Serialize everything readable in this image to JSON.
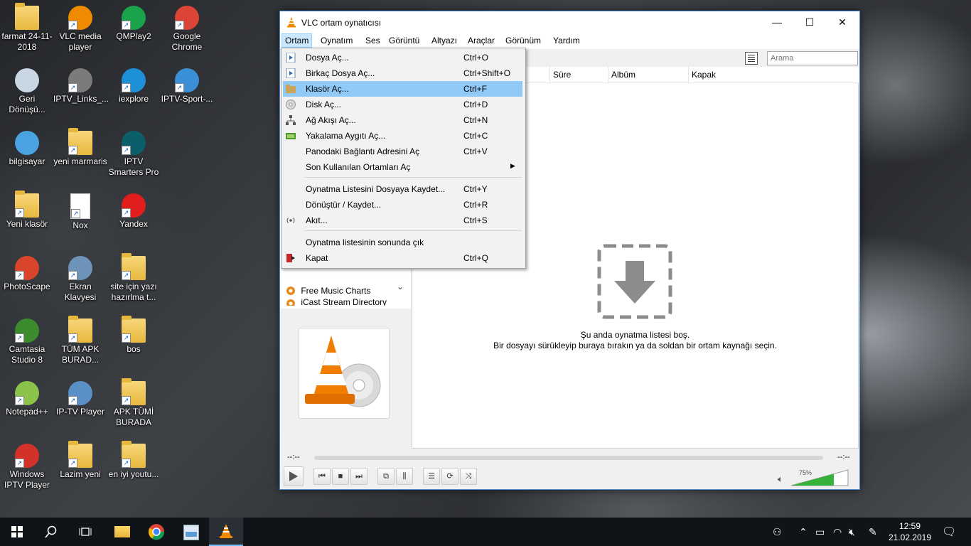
{
  "desktop": {
    "icons": [
      {
        "label": "farmat 24-11-2018",
        "icon": "folder-icon"
      },
      {
        "label": "VLC media player",
        "icon": "vlc-icon"
      },
      {
        "label": "QMPlay2",
        "icon": "qmplay-icon"
      },
      {
        "label": "Google Chrome",
        "icon": "chrome-icon"
      },
      {
        "label": "Geri Dönüşü...",
        "icon": "recycle-bin-icon"
      },
      {
        "label": "IPTV_Links_...",
        "icon": "media-icon"
      },
      {
        "label": "iexplore",
        "icon": "ie-icon"
      },
      {
        "label": "IPTV-Sport-...",
        "icon": "file-icon"
      },
      {
        "label": "bilgisayar",
        "icon": "computer-icon"
      },
      {
        "label": "yeni marmaris",
        "icon": "folder-doc-icon"
      },
      {
        "label": "IPTV Smarters Pro",
        "icon": "iptv-smarters-icon"
      },
      {
        "label": "Yeni klasör",
        "icon": "folder-icon"
      },
      {
        "label": "Nox",
        "icon": "document-icon"
      },
      {
        "label": "Yandex",
        "icon": "yandex-icon"
      },
      {
        "label": "PhotoScape",
        "icon": "photoscape-icon"
      },
      {
        "label": "Ekran Klavyesi",
        "icon": "keyboard-icon"
      },
      {
        "label": "site için yazı hazırlma t...",
        "icon": "folder-doc-icon"
      },
      {
        "label": "Camtasia Studio 8",
        "icon": "camtasia-icon"
      },
      {
        "label": "TÜM APK BURAD...",
        "icon": "folder-doc-icon"
      },
      {
        "label": "bos",
        "icon": "folder-doc-icon"
      },
      {
        "label": "Notepad++",
        "icon": "notepad-icon"
      },
      {
        "label": "IP-TV Player",
        "icon": "tv-icon"
      },
      {
        "label": "APK TÜMİ BURADA",
        "icon": "folder-icon"
      },
      {
        "label": "Windows IPTV Player",
        "icon": "play-icon"
      },
      {
        "label": "Lazim yeni",
        "icon": "folder-doc-icon"
      },
      {
        "label": "en iyi youtu...",
        "icon": "folder-doc-icon"
      }
    ]
  },
  "vlc": {
    "title": "VLC ortam oynatıcısı",
    "menu": [
      "Ortam",
      "Oynatım",
      "Ses",
      "Görüntü",
      "Altyazı",
      "Araçlar",
      "Görünüm",
      "Yardım"
    ],
    "search_placeholder": "Arama",
    "columns": [
      "Süre",
      "Albüm",
      "Kapak"
    ],
    "sidebar_items": [
      "Free Music Charts",
      "iCast Stream Directory"
    ],
    "empty_line1": "Şu anda oynatma listesi boş.",
    "empty_line2": "Bir dosyayı sürükleyip buraya bırakın ya da soldan bir ortam kaynağı seçin.",
    "time_left": "--:--",
    "time_right": "--:--",
    "volume": "75%",
    "volume_level": 0.75
  },
  "dropdown": {
    "items": [
      {
        "label": "Dosya Aç...",
        "shortcut": "Ctrl+O",
        "icon": "file-play-icon"
      },
      {
        "label": "Birkaç Dosya Aç...",
        "shortcut": "Ctrl+Shift+O",
        "icon": "files-play-icon"
      },
      {
        "label": "Klasör Aç...",
        "shortcut": "Ctrl+F",
        "icon": "folder-icon",
        "highlight": true
      },
      {
        "label": "Disk Aç...",
        "shortcut": "Ctrl+D",
        "icon": "disc-icon"
      },
      {
        "label": "Ağ Akışı Aç...",
        "shortcut": "Ctrl+N",
        "icon": "network-icon"
      },
      {
        "label": "Yakalama Aygıtı Aç...",
        "shortcut": "Ctrl+C",
        "icon": "capture-card-icon"
      },
      {
        "label": "Panodaki Bağlantı Adresini Aç",
        "shortcut": "Ctrl+V"
      },
      {
        "label": "Son Kullanılan Ortamları Aç",
        "shortcut": "",
        "submenu": true
      },
      {
        "label": "Oynatma Listesini Dosyaya Kaydet...",
        "shortcut": "Ctrl+Y"
      },
      {
        "label": "Dönüştür / Kaydet...",
        "shortcut": "Ctrl+R"
      },
      {
        "label": "Akıt...",
        "shortcut": "Ctrl+S",
        "icon": "stream-icon"
      },
      {
        "label": "Oynatma listesinin sonunda çık",
        "shortcut": ""
      },
      {
        "label": "Kapat",
        "shortcut": "Ctrl+Q",
        "icon": "exit-icon"
      }
    ]
  },
  "taskbar": {
    "time": "12:59",
    "date": "21.02.2019"
  }
}
